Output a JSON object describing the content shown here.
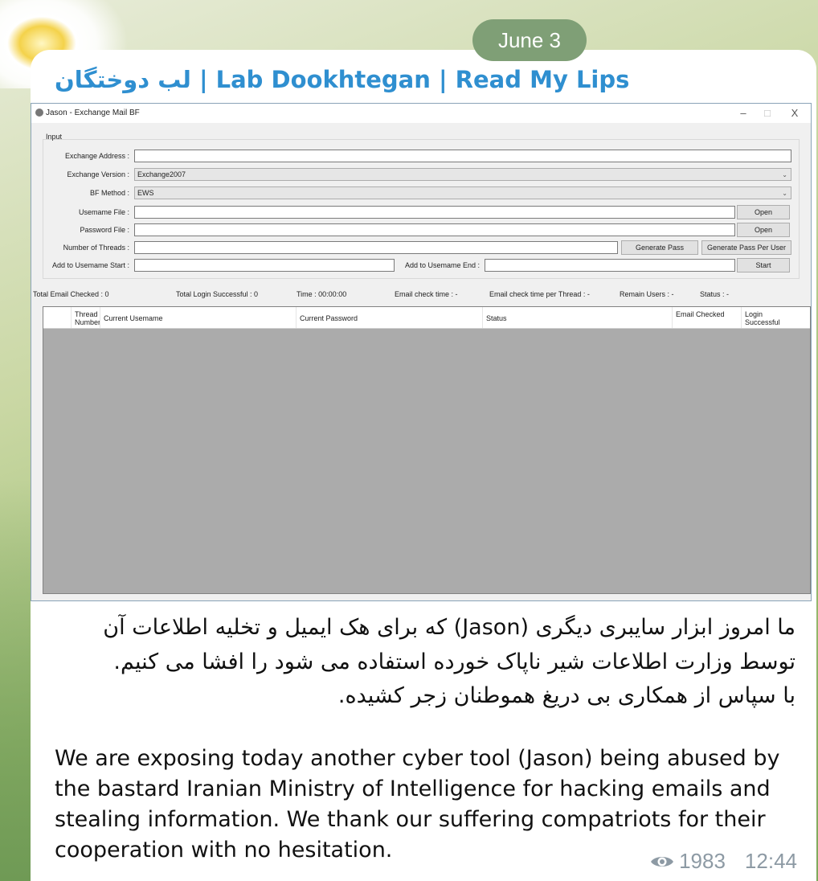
{
  "message": {
    "date": "June 3",
    "channel_title": "لب دوختگان | Lab Dookhtegan | Read My Lips",
    "persian_lines": [
      "ما امروز ابزار سایبری دیگری (Jason) که برای هک ایمیل و تخلیه اطلاعات آن",
      "توسط وزارت اطلاعات شیر ناپاک خورده استفاده می شود را افشا می کنیم.",
      "با سپاس از همکاری بی دریغ هموطنان زجر کشیده."
    ],
    "english_text": "We are exposing today another cyber tool (Jason) being abused by the bastard Iranian Ministry of Intelligence for hacking emails and stealing information. We thank our suffering compatriots for their cooperation with no hesitation.",
    "views": "1983",
    "time": "12:44",
    "icons": {
      "views": "eye-icon"
    },
    "colors": {
      "title": "#2f8fd0",
      "date_pill": "#7f9f76",
      "meta": "#8d9aa4"
    }
  },
  "window": {
    "title": "Jason - Exchange Mail BF",
    "controls": {
      "minimize": "–",
      "maximize": "□",
      "close": "X"
    },
    "input_group_label": "Input",
    "fields": {
      "exchange_address_label": "Exchange Address :",
      "exchange_address_value": "",
      "exchange_version_label": "Exchange Version :",
      "exchange_version_value": "Exchange2007",
      "bf_method_label": "BF Method :",
      "bf_method_value": "EWS",
      "username_file_label": "Usemame File :",
      "password_file_label": "Password File :",
      "threads_label": "Number of Threads :",
      "add_start_label": "Add to Usemame Start :",
      "add_end_label": "Add to Usemame End :"
    },
    "buttons": {
      "open_username": "Open",
      "open_password": "Open",
      "generate_pass": "Generate Pass",
      "generate_pass_per_user": "Generate Pass Per User",
      "start": "Start"
    },
    "status": {
      "total_checked": "Total Email Checked :  0",
      "total_success": "Total Login Successful :  0",
      "time": "Time :  00:00:00",
      "email_check_time": "Email check time :  -",
      "per_thread": "Email check time per Thread :  -",
      "remain": "Remain Users :  -",
      "status": "Status :  -"
    },
    "table_headers": [
      "Thread Number",
      "Current Usemame",
      "Current Password",
      "Status",
      "Email Checked",
      "Login Successful"
    ]
  }
}
